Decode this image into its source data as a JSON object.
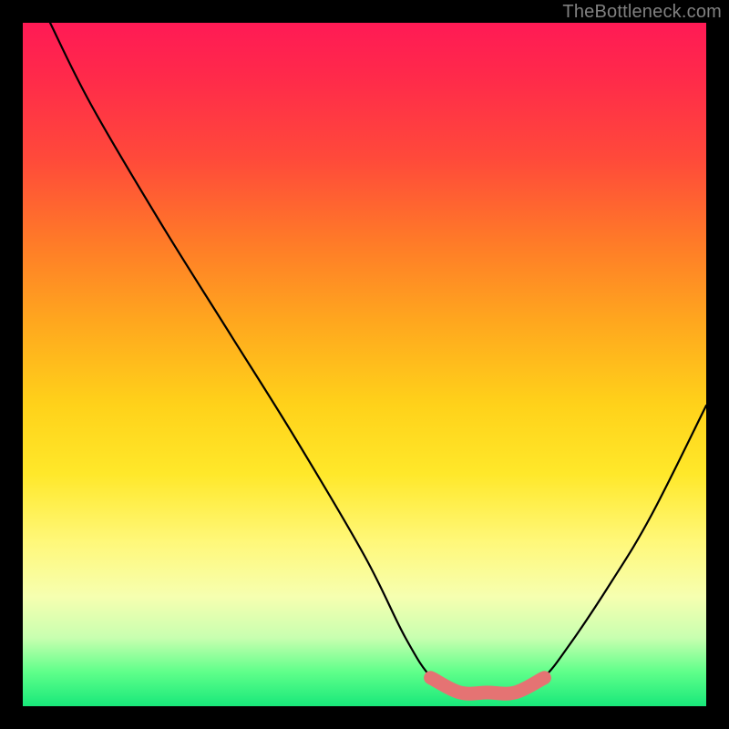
{
  "attribution": "TheBottleneck.com",
  "colors": {
    "coral": "#e57373",
    "curve": "#000000",
    "background_frame": "#000000"
  },
  "chart_data": {
    "type": "line",
    "title": "",
    "xlabel": "",
    "ylabel": "",
    "xlim": [
      0,
      100
    ],
    "ylim": [
      0,
      100
    ],
    "grid": false,
    "legend": false,
    "series": [
      {
        "name": "curve",
        "x": [
          4,
          10,
          20,
          30,
          40,
          50,
          56,
          60,
          64,
          68,
          72,
          76,
          80,
          86,
          92,
          100
        ],
        "y": [
          100,
          88,
          71,
          55,
          39,
          22,
          10,
          4,
          2,
          2,
          2,
          4,
          9,
          18,
          28,
          44
        ]
      }
    ],
    "highlight_segment": {
      "name": "coral-band",
      "xrange": [
        60,
        76
      ],
      "y_approx": 2
    },
    "highlight_dot": {
      "name": "coral-dot",
      "x": 57.5,
      "y": 7
    },
    "background_gradient": {
      "direction": "vertical",
      "stops": [
        {
          "pos": 0.0,
          "color": "#ff1a55"
        },
        {
          "pos": 0.5,
          "color": "#ffd21a"
        },
        {
          "pos": 0.85,
          "color": "#f6ffb0"
        },
        {
          "pos": 1.0,
          "color": "#18e87a"
        }
      ]
    }
  }
}
